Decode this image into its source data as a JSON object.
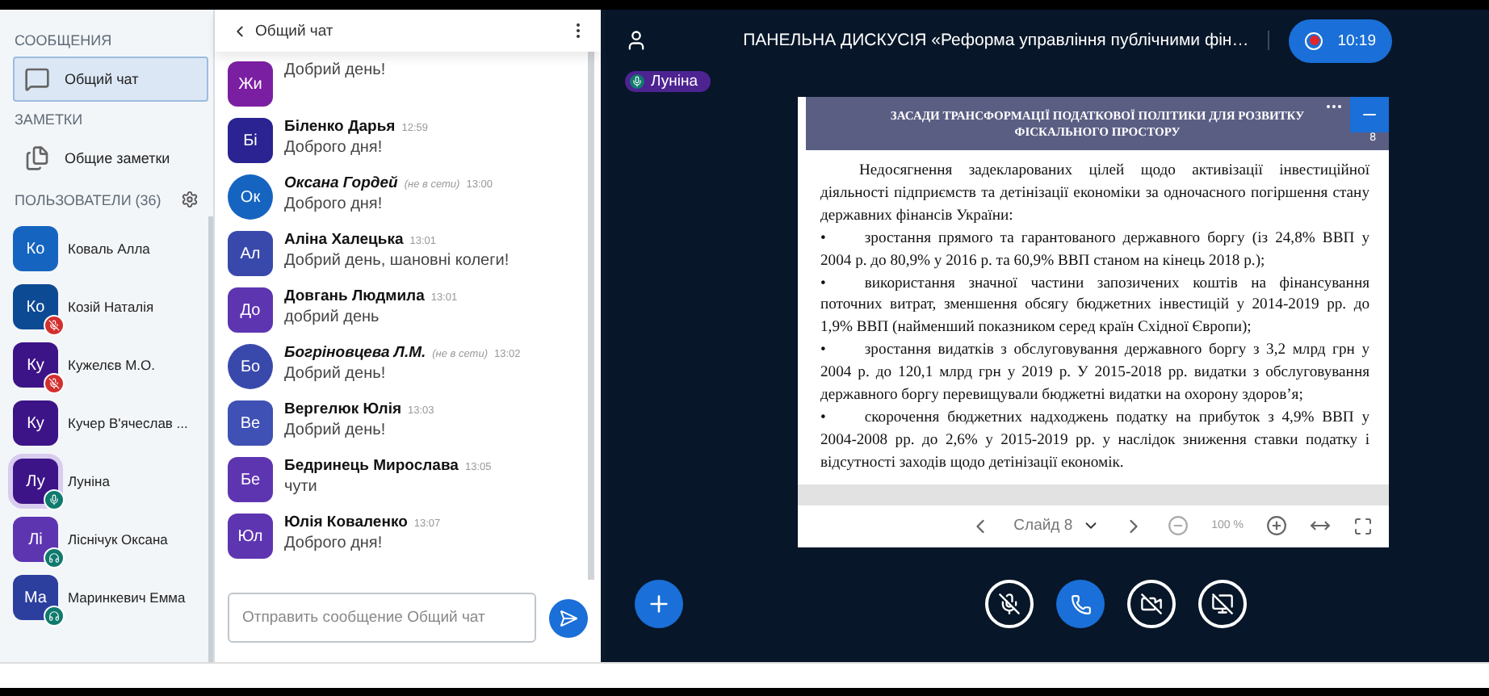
{
  "sidebar": {
    "messages_heading": "СООБЩЕНИЯ",
    "chats": [
      {
        "label": "Общий чат",
        "selected": true
      }
    ],
    "notes_heading": "ЗАМЕТКИ",
    "notes": [
      {
        "label": "Общие заметки"
      }
    ],
    "users_heading": "ПОЛЬЗОВАТЕЛИ (36)",
    "users": [
      {
        "initials": "Ко",
        "name": "Коваль Алла",
        "color": "#1565c0",
        "muted": false,
        "talking": false,
        "listening": false,
        "selected": false
      },
      {
        "initials": "Ко",
        "name": "Козій Наталія",
        "color": "#0d4a94",
        "muted": true,
        "talking": false,
        "listening": false,
        "selected": false
      },
      {
        "initials": "Ку",
        "name": "Кужелєв М.О.",
        "color": "#3c1487",
        "muted": true,
        "talking": false,
        "listening": false,
        "selected": false
      },
      {
        "initials": "Ку",
        "name": "Кучер В'ячеслав ...",
        "color": "#3c1487",
        "muted": false,
        "talking": false,
        "listening": false,
        "selected": false
      },
      {
        "initials": "Лу",
        "name": "Луніна",
        "color": "#3c1487",
        "muted": false,
        "talking": true,
        "listening": false,
        "selected": true
      },
      {
        "initials": "Лі",
        "name": "Ліснічук Оксана",
        "color": "#5e35b1",
        "muted": false,
        "talking": false,
        "listening": true,
        "selected": false
      },
      {
        "initials": "Ма",
        "name": "Маринкевич Емма",
        "color": "#2c3e9e",
        "muted": false,
        "talking": false,
        "listening": true,
        "selected": false
      }
    ]
  },
  "chat": {
    "title": "Общий чат",
    "messages": [
      {
        "initials": "Жи",
        "color": "#7b1fa2",
        "text": "Добрий день!",
        "offline": false
      },
      {
        "initials": "Бі",
        "name": "Біленко Дарья",
        "time": "12:59",
        "color": "#2a2391",
        "text": "Доброго дня!",
        "offline": false
      },
      {
        "initials": "Ок",
        "name": "Оксана Гордей",
        "note": "(не в сети)",
        "time": "13:00",
        "color": "#1565c0",
        "text": "Доброго дня!",
        "offline": true
      },
      {
        "initials": "Ал",
        "name": "Аліна Халецька",
        "time": "13:01",
        "color": "#3949ab",
        "text": "Добрий день, шановні колеги!",
        "offline": false
      },
      {
        "initials": "До",
        "name": "Довгань Людмила",
        "time": "13:01",
        "color": "#5e35b1",
        "text": "добрий день",
        "offline": false
      },
      {
        "initials": "Бо",
        "name": "Богріновцева Л.М.",
        "note": "(не в сети)",
        "time": "13:02",
        "color": "#3949ab",
        "text": "Добрий день!",
        "offline": true
      },
      {
        "initials": "Ве",
        "name": "Вергелюк Юлія",
        "time": "13:03",
        "color": "#3f51b5",
        "text": "Добрий день!",
        "offline": false
      },
      {
        "initials": "Бе",
        "name": "Бедринець Мирослава",
        "time": "13:05",
        "color": "#5e35b1",
        "text": "чути",
        "offline": false
      },
      {
        "initials": "Юл",
        "name": "Юлія Коваленко",
        "time": "13:07",
        "color": "#5e35b1",
        "text": "Доброго дня!",
        "offline": false
      }
    ],
    "input": {
      "placeholder": "Отправить сообщение Общий чат"
    }
  },
  "presentation": {
    "title": "ПАНЕЛЬНА ДИСКУСІЯ «Реформа управління публічними фін…",
    "recording": {
      "on": true,
      "time": "10:19"
    },
    "talking": {
      "name": "Луніна"
    },
    "slide": {
      "title": "ЗАСАДИ ТРАНСФОРМАЦІЇ  ПОДАТКОВОЇ ПОЛІТИКИ ДЛЯ РОЗВИТКУ ФІСКАЛЬНОГО ПРОСТОРУ",
      "number": "8",
      "intro": "Недосягнення задекларованих цілей щодо активізації інвестиційної діяльності підприємств та детінізації економіки за одночасного погіршення стану державних фінансів України:",
      "bullets": [
        {
          "mark": "•",
          "text": "зростання прямого та гарантованого державного боргу (із 24,8% ВВП у 2004 р. до 80,9% у 2016 р. та 60,9% ВВП станом на кінець 2018 р.);"
        },
        {
          "mark": "•",
          "text": "використання значної частини запозичених коштів на фінансування поточних витрат, зменшення обсягу бюджетних інвестицій у 2014-2019 рр. до 1,9% ВВП (найменший показником серед країн Східної Європи);"
        },
        {
          "mark": "•",
          "text": "зростання видатків з обслуговування державного боргу з 3,2 млрд грн у 2004 р. до 120,1 млрд грн у 2019 р. У 2015-2018 рр. видатки з обслуговування державного боргу перевищували бюджетні видатки на охорону здоров’я;"
        },
        {
          "mark": "•",
          "text": "скорочення бюджетних надходжень податку на прибуток з 4,9% ВВП у 2004-2008  рр. до 2,6% у 2015-2019 рр. у наслідок зниження ставки податку і відсутності заходів щодо детінізації економік."
        }
      ]
    },
    "toolbar": {
      "slide_label": "Слайд 8",
      "zoom": "100 %"
    },
    "controls": {
      "mic_muted": true,
      "camera_on": false,
      "screen_sharing": false
    }
  }
}
